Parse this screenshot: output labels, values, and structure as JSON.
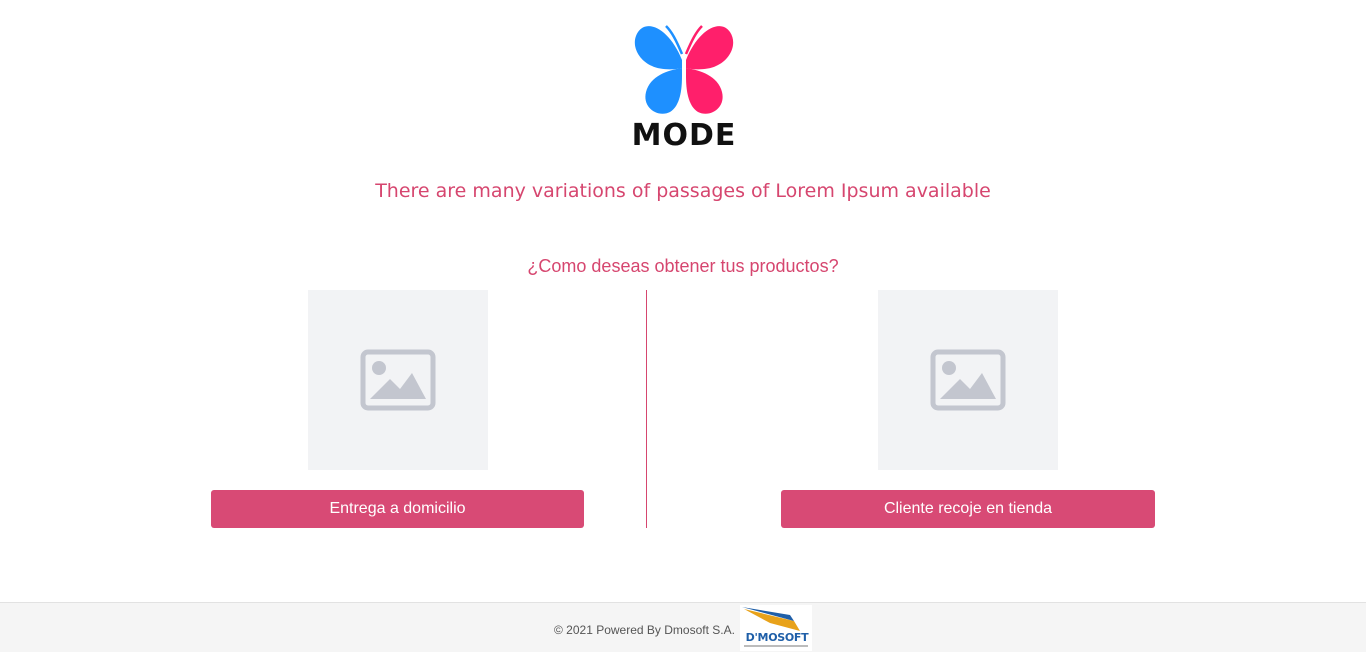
{
  "brand": {
    "logo_text": "MODE",
    "colors": {
      "wing_left": "#1e90ff",
      "wing_right": "#ff1f6b",
      "accent": "#d6466f",
      "button": "#d84a75"
    }
  },
  "headline": "There are many variations of passages of Lorem Ipsum available",
  "question": "¿Como deseas obtener tus productos?",
  "options": [
    {
      "label": "Entrega a domicilio",
      "image_icon": "image-placeholder-icon"
    },
    {
      "label": "Cliente recoje en tienda",
      "image_icon": "image-placeholder-icon"
    }
  ],
  "footer": {
    "text": "© 2021 Powered By Dmosoft S.A.",
    "partner_logo_text": "D'MOSOFT"
  }
}
